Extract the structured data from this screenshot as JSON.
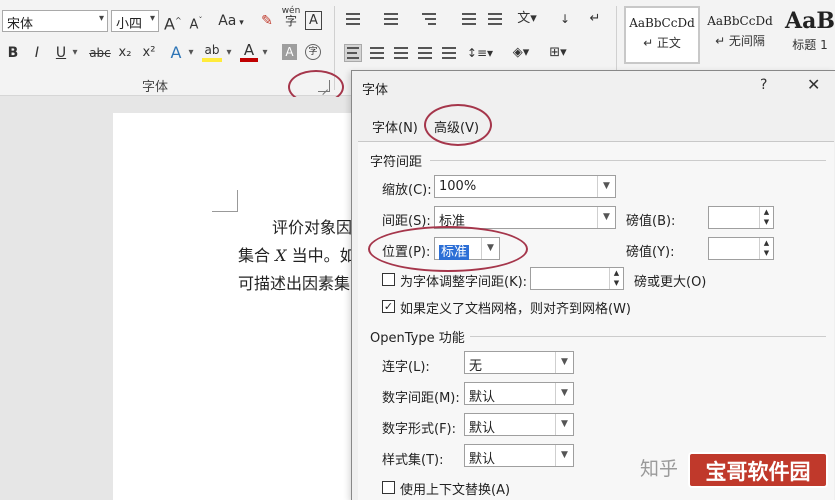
{
  "ribbon": {
    "font_name": "宋体",
    "font_size": "小四",
    "grow_font": "A",
    "shrink_font": "A",
    "change_case": "Aa",
    "bold": "B",
    "italic": "I",
    "underline": "U",
    "strikethrough": "abc",
    "subscript": "x₂",
    "superscript": "x²",
    "text_effects": "A",
    "highlight": "ab",
    "font_color": "A",
    "char_shading": "A",
    "enclose_char": "字",
    "phonetic": "wén",
    "char_border": "A",
    "font_group_label": "字体"
  },
  "styles": [
    {
      "sample": "AaBbCcDd",
      "name": "↵ 正文"
    },
    {
      "sample": "AaBbCcDd",
      "name": "↵ 无间隔"
    },
    {
      "sample": "AaB",
      "name": "标题 1"
    }
  ],
  "document": {
    "line1": "评价对象因",
    "line2_a": "集合",
    "line2_var": "X",
    "line2_b": "当中。如",
    "line3": "可描述出因素集"
  },
  "dialog": {
    "title": "字体",
    "help": "?",
    "close": "✕",
    "tabs": [
      "字体(N)",
      "高级(V)"
    ],
    "char_spacing_section": "字符间距",
    "scale_label": "缩放(C):",
    "scale_value": "100%",
    "spacing_label": "间距(S):",
    "spacing_value": "标准",
    "by1_label": "磅值(B):",
    "position_label": "位置(P):",
    "position_value": "标准",
    "by2_label": "磅值(Y):",
    "kerning_label": "为字体调整字间距(K):",
    "kerning_suffix": "磅或更大(O)",
    "grid_label": "如果定义了文档网格，则对齐到网格(W)",
    "opentype_section": "OpenType 功能",
    "ligatures_label": "连字(L):",
    "ligatures_value": "无",
    "num_spacing_label": "数字间距(M):",
    "num_spacing_value": "默认",
    "num_forms_label": "数字形式(F):",
    "num_forms_value": "默认",
    "stylistic_label": "样式集(T):",
    "stylistic_value": "默认",
    "contextual_label": "使用上下文替换(A)"
  },
  "watermark": {
    "zhihu": "知乎",
    "site": "宝哥软件园"
  },
  "colors": {
    "annotation": "#a5364b",
    "selection": "#2d6fd6",
    "watermark_bg": "#c0392b"
  }
}
